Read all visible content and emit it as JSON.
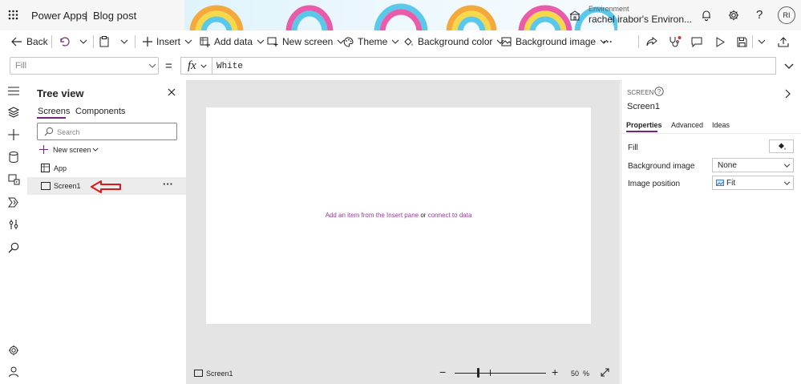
{
  "header": {
    "app_name": "Power Apps",
    "separator": "|",
    "app_title": "Blog post",
    "env_label": "Environment",
    "env_name": "rachel irabor's Environ...",
    "avatar_initials": "RI"
  },
  "commandbar": {
    "back": "Back",
    "insert": "Insert",
    "add_data": "Add data",
    "new_screen": "New screen",
    "theme": "Theme",
    "background_color": "Background color",
    "background_image": "Background image",
    "more": "···"
  },
  "formula": {
    "property": "Fill",
    "equals": "=",
    "fx": "fx",
    "value": "White"
  },
  "tree": {
    "title": "Tree view",
    "tabs": [
      "Screens",
      "Components"
    ],
    "search_placeholder": "Search",
    "new_screen": "New screen",
    "items": [
      {
        "label": "App"
      },
      {
        "label": "Screen1"
      }
    ],
    "item_more": "···"
  },
  "canvas": {
    "hint_link1": "Add an item from the Insert pane",
    "hint_or": "or",
    "hint_link2": "connect to data"
  },
  "statusbar": {
    "screen_label": "Screen1",
    "zoom_minus": "−",
    "zoom_plus": "+",
    "zoom_value": "50",
    "zoom_unit": "%"
  },
  "properties": {
    "section": "SCREEN",
    "screen_name": "Screen1",
    "tabs": [
      "Properties",
      "Advanced",
      "Ideas"
    ],
    "fill_label": "Fill",
    "bg_image_label": "Background image",
    "bg_image_value": "None",
    "img_pos_label": "Image position",
    "img_pos_value": "Fit"
  },
  "colors": {
    "accent": "#742774",
    "link": "#9b3a9b",
    "arrow": "#d91a1a"
  }
}
